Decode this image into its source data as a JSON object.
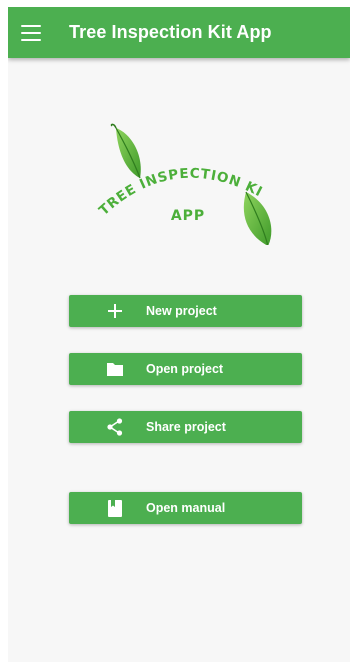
{
  "app_bar": {
    "title": "Tree Inspection Kit App",
    "menu_icon": "hamburger-menu-icon"
  },
  "logo": {
    "line1": "TREE INSPECTION KIT",
    "line2": "APP"
  },
  "buttons": [
    {
      "id": "new",
      "label": "New project",
      "icon": "plus-icon"
    },
    {
      "id": "open",
      "label": "Open project",
      "icon": "folder-icon"
    },
    {
      "id": "share",
      "label": "Share project",
      "icon": "share-icon"
    },
    {
      "id": "manual",
      "label": "Open manual",
      "icon": "book-icon"
    }
  ],
  "colors": {
    "primary": "#4caf50",
    "leaf": "#6cc04a",
    "leaf_dark": "#3f9a2a",
    "background": "#f7f7f7",
    "on_primary": "#ffffff"
  }
}
